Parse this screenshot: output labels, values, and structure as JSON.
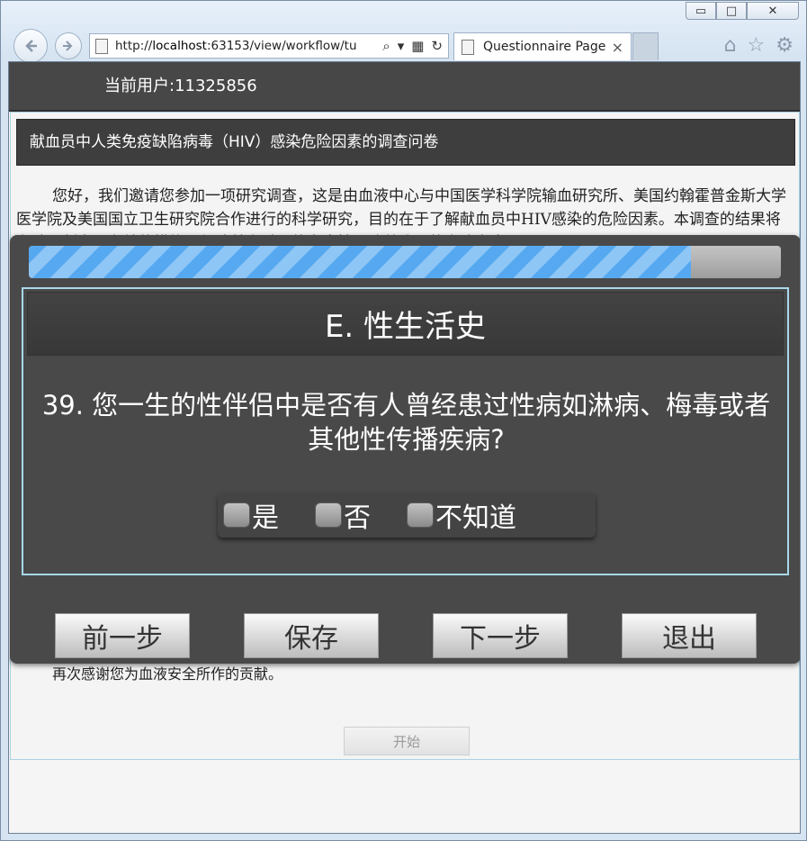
{
  "browser": {
    "window_controls": {
      "minimize": "▭",
      "maximize": "□",
      "close": "✕"
    },
    "back_icon": "back-arrow-icon",
    "forward_icon": "forward-arrow-icon",
    "address": {
      "prefix": "http://",
      "host": "localhost",
      "rest": ":63153/view/workflow/tu"
    },
    "address_tools": {
      "search": "⌕",
      "dropdown": "▾",
      "compat": "▦",
      "refresh": "↻"
    },
    "tab": {
      "title": "Questionnaire Page",
      "close": "×"
    },
    "toolbar_icons": {
      "home": "⌂",
      "favorites": "☆",
      "settings": "⚙"
    }
  },
  "header": {
    "current_user_label": "当前用户:",
    "user_id": "11325856"
  },
  "survey": {
    "title": "献血员中人类免疫缺陷病毒（HIV）感染危险因素的调查问卷",
    "intro": "您好，我们邀请您参加一项研究调查，这是由血液中心与中国医学科学院输血研究所、美国约翰霍普金斯大学医学院及美国国立卫生研究院合作进行的科学研究，目的在于了解献血员中HIV感染的危险因素。本调查的结果将有助于制定更有效的措施，保障献血过程的安全性，改善我国的血液安全。",
    "thanks": "再次感谢您为血液安全所作的贡献。",
    "start_button": "开始"
  },
  "modal": {
    "progress_percent": 88,
    "section_title": "E. 性生活史",
    "question": "39. 您一生的性伴侣中是否有人曾经患过性病如淋病、梅毒或者其他性传播疾病?",
    "options": [
      {
        "label": "是",
        "checked": false
      },
      {
        "label": "否",
        "checked": false
      },
      {
        "label": "不知道",
        "checked": false
      }
    ],
    "buttons": {
      "prev": "前一步",
      "save": "保存",
      "next": "下一步",
      "exit": "退出"
    }
  },
  "colors": {
    "progress": "#56a9f0",
    "header_bg": "#474747",
    "modal_bg": "#494949",
    "frame_border": "#aad3e5"
  }
}
